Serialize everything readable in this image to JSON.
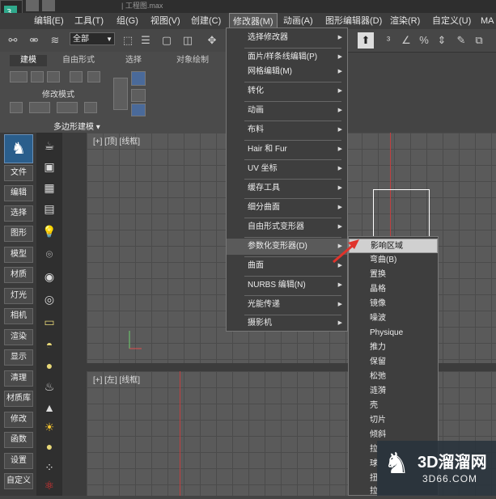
{
  "titlebar": {
    "document": "| 工程图.max"
  },
  "menubar": {
    "items": [
      "编辑(E)",
      "工具(T)",
      "组(G)",
      "视图(V)",
      "创建(C)",
      "修改器(M)",
      "动画(A)",
      "图形编辑器(D)",
      "渲染(R)",
      "自定义(U)",
      "MA"
    ]
  },
  "toolbar": {
    "selection_filter": "全部"
  },
  "ribbon": {
    "tabs": [
      "建模",
      "自由形式",
      "选择",
      "对象绘制"
    ],
    "panel_label": "修改模式",
    "panel_footer": "多边形建模 ▾"
  },
  "sidebar": {
    "items": [
      "文件",
      "编辑",
      "选择",
      "图形",
      "模型",
      "材质",
      "灯光",
      "相机",
      "渲染",
      "显示",
      "清理",
      "材质库",
      "修改",
      "函数",
      "设置",
      "自定义"
    ]
  },
  "viewports": {
    "top_left_label": "[+] [顶] [线框]",
    "bottom_left_label": "[+] [左] [线框]"
  },
  "modifiers_menu": {
    "items": [
      {
        "label": "选择修改器",
        "has_sub": true
      },
      {
        "label": "面片/样条线编辑(P)",
        "has_sub": true
      },
      {
        "label": "网格编辑(M)",
        "has_sub": true
      },
      {
        "label": "转化",
        "has_sub": true
      },
      {
        "label": "动画",
        "has_sub": true
      },
      {
        "label": "布料",
        "has_sub": true
      },
      {
        "label": "Hair 和 Fur",
        "has_sub": true
      },
      {
        "label": "UV 坐标",
        "has_sub": true
      },
      {
        "label": "缓存工具",
        "has_sub": true
      },
      {
        "label": "细分曲面",
        "has_sub": true
      },
      {
        "label": "自由形式变形器",
        "has_sub": true
      },
      {
        "label": "参数化变形器(D)",
        "has_sub": true
      },
      {
        "label": "曲面",
        "has_sub": true
      },
      {
        "label": "NURBS 编辑(N)",
        "has_sub": true
      },
      {
        "label": "光能传递",
        "has_sub": true
      },
      {
        "label": "摄影机",
        "has_sub": true
      }
    ]
  },
  "parametric_submenu": {
    "items": [
      "影响区域",
      "弯曲(B)",
      "置换",
      "晶格",
      "镜像",
      "噪波",
      "Physique",
      "推力",
      "保留",
      "松弛",
      "涟漪",
      "壳",
      "切片",
      "倾斜",
      "拉",
      "球",
      "扭",
      "拉"
    ]
  },
  "watermark": {
    "title": "3D溜溜网",
    "subtitle": "3D66.COM"
  },
  "colors": {
    "highlight_arrow": "#e0332b",
    "menu_bg": "#3e3e3e",
    "accent_red": "#c0392b"
  }
}
